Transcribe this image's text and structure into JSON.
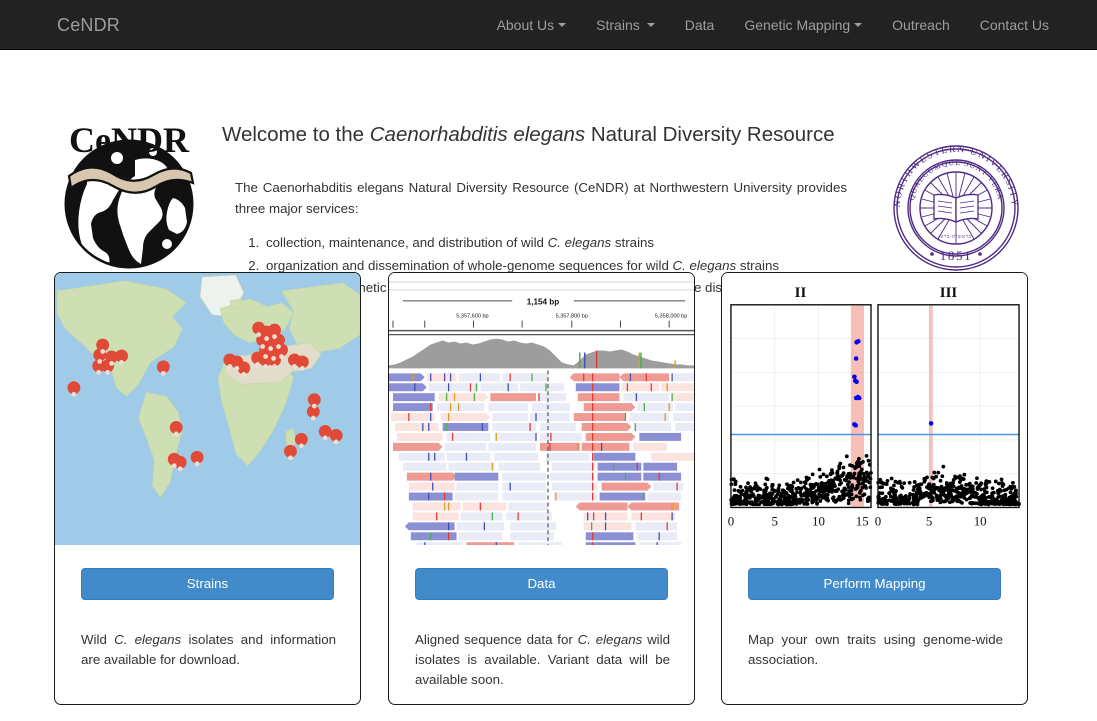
{
  "navbar": {
    "brand": "CeNDR",
    "items": [
      {
        "label": "About Us",
        "caret": true
      },
      {
        "label": "Strains",
        "caret": true
      },
      {
        "label": "Data",
        "caret": false
      },
      {
        "label": "Genetic Mapping",
        "caret": true
      },
      {
        "label": "Outreach",
        "caret": false
      },
      {
        "label": "Contact Us",
        "caret": false
      }
    ]
  },
  "hero": {
    "logo_text": "CeNDR",
    "title_pre": "Welcome to the ",
    "title_em": "Caenorhabditis elegans",
    "title_post": " Natural Diversity Resource",
    "paragraph": "The Caenorhabditis elegans Natural Diversity Resource (CeNDR) at Northwestern University provides three major services:",
    "services": [
      {
        "pre": "collection, maintenance, and distribution of wild ",
        "em": "C. elegans",
        "post": " strains"
      },
      {
        "pre": "organization and dissemination of whole-genome sequences for wild ",
        "em": "C. elegans",
        "post": " strains"
      },
      {
        "pre": "facilitation of genetic mappings to empower individual researchers in gene discovery",
        "em": "",
        "post": ""
      }
    ],
    "seal": {
      "outer_text": "NORTHWESTERN UNIVERSITY",
      "inner_text": "QUAECUMQUE SUNT VERA",
      "year": "1851",
      "color": "#4e2a84"
    }
  },
  "cards": [
    {
      "id": "strains",
      "media": "world-map-with-collection-pins",
      "button_label": "Strains",
      "description_pre": "Wild ",
      "description_em": "C. elegans",
      "description_post": " isolates and information are available for download."
    },
    {
      "id": "data",
      "media": "genome-browser-alignment-track",
      "button_label": "Data",
      "description_pre": "Aligned sequence data for ",
      "description_em": "C. elegans",
      "description_post": " wild isolates is available. Variant data will be available soon."
    },
    {
      "id": "mapping",
      "media": "manhattan-plot",
      "button_label": "Perform Mapping",
      "description_pre": "Map your own traits using genome-wide association.",
      "description_em": "",
      "description_post": ""
    }
  ],
  "genome_browser": {
    "span_label": "1,154 bp",
    "ticks": [
      "5,357,600 bp",
      "5,357,800 bp",
      "5,358,000 bp"
    ]
  },
  "chart_data": {
    "type": "scatter",
    "title": "",
    "xlabel": "",
    "ylabel": "",
    "panels": [
      {
        "name": "II",
        "xticks": [
          0,
          5,
          10,
          15
        ],
        "xlim": [
          0,
          16
        ],
        "ylim": [
          0,
          10
        ],
        "significance_line_y": 3.6,
        "highlight_band": {
          "x_start": 13.7,
          "x_end": 15.2,
          "color": "#f4a9a0"
        },
        "significant_points": [
          {
            "x": 14.35,
            "y": 8.15
          },
          {
            "x": 14.55,
            "y": 8.2
          },
          {
            "x": 14.3,
            "y": 7.35
          },
          {
            "x": 14.1,
            "y": 6.45
          },
          {
            "x": 14.2,
            "y": 6.25
          },
          {
            "x": 14.35,
            "y": 6.2
          },
          {
            "x": 14.3,
            "y": 5.4
          },
          {
            "x": 14.5,
            "y": 5.45
          },
          {
            "x": 14.65,
            "y": 5.4
          },
          {
            "x": 14.1,
            "y": 4.1
          },
          {
            "x": 14.25,
            "y": 4.05
          }
        ]
      },
      {
        "name": "III",
        "xticks": [
          0,
          5,
          10
        ],
        "xlim": [
          0,
          13.8
        ],
        "ylim": [
          0,
          10
        ],
        "significance_line_y": 3.6,
        "highlight_band": {
          "x_start": 5.0,
          "x_end": 5.35,
          "color": "#f4a9a0"
        },
        "significant_points": [
          {
            "x": 5.2,
            "y": 4.15
          }
        ]
      }
    ],
    "point_color": "#000000",
    "significant_color": "#0000ee",
    "threshold_color": "#4d94ea",
    "grid": true,
    "legend": "none"
  },
  "colors": {
    "navbar_bg": "#222222",
    "navbar_text": "#9d9d9d",
    "primary_button": "#428bca",
    "button_border": "#357ebd",
    "page_bg": "#ffffff",
    "body_text": "#333333",
    "map_ocean": "#a0cbe8",
    "map_land": "#c9dfb0",
    "map_pin": "#e04a36"
  }
}
